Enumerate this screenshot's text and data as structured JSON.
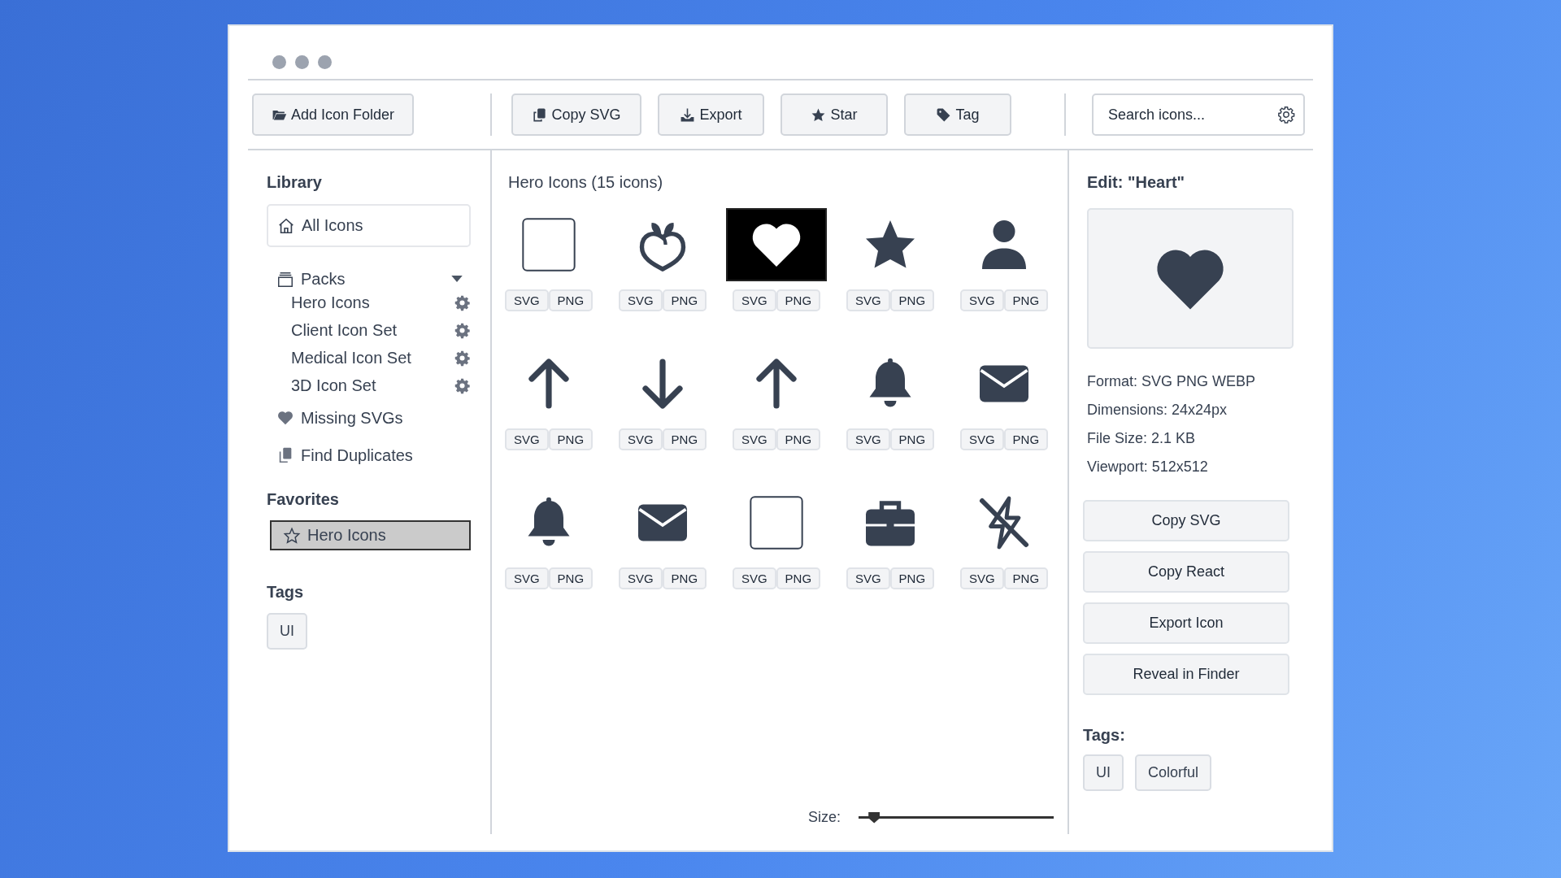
{
  "toolbar": {
    "primary": {
      "kind": "folder",
      "label": "Add Icon Folder"
    },
    "actions": [
      {
        "kind": "copy",
        "label": "Copy SVG"
      },
      {
        "kind": "download",
        "label": "Export"
      },
      {
        "kind": "star",
        "label": "Star"
      },
      {
        "kind": "tag",
        "label": "Tag"
      }
    ],
    "search": {
      "placeholder": "Search icons..."
    }
  },
  "sidebar": {
    "library": {
      "heading": "Library",
      "all": {
        "label": "All Icons",
        "selected": true
      },
      "packs": {
        "label": "Packs",
        "expanded": true,
        "children": [
          {
            "label": "Hero Icons"
          },
          {
            "label": "Client Icon Set"
          },
          {
            "label": "Medical Icon Set"
          },
          {
            "label": "3D Icon Set"
          }
        ]
      },
      "links": [
        {
          "kind": "heart",
          "label": "Missing SVGs"
        },
        {
          "kind": "duplicates",
          "label": "Find Duplicates"
        }
      ]
    },
    "favorites": {
      "heading": "Favorites",
      "items": [
        {
          "label": "Hero Icons",
          "selected": true
        }
      ]
    },
    "tags": {
      "heading": "Tags",
      "items": [
        "UI"
      ]
    }
  },
  "grid": {
    "title": "Hero Icons (15 icons)",
    "items": [
      {
        "kind": "square",
        "selected": false,
        "formats": [
          "SVG",
          "PNG"
        ]
      },
      {
        "kind": "peach",
        "selected": false,
        "formats": [
          "SVG",
          "PNG"
        ]
      },
      {
        "kind": "heart",
        "selected": true,
        "formats": [
          "SVG",
          "PNG"
        ]
      },
      {
        "kind": "star",
        "selected": false,
        "formats": [
          "SVG",
          "PNG"
        ]
      },
      {
        "kind": "user",
        "selected": false,
        "formats": [
          "SVG",
          "PNG"
        ]
      },
      {
        "kind": "arrow-up",
        "selected": false,
        "formats": [
          "SVG",
          "PNG"
        ]
      },
      {
        "kind": "arrow-down",
        "selected": false,
        "formats": [
          "SVG",
          "PNG"
        ]
      },
      {
        "kind": "arrow-up",
        "selected": false,
        "formats": [
          "SVG",
          "PNG"
        ]
      },
      {
        "kind": "bell",
        "selected": false,
        "formats": [
          "SVG",
          "PNG"
        ]
      },
      {
        "kind": "envelope",
        "selected": false,
        "formats": [
          "SVG",
          "PNG"
        ]
      },
      {
        "kind": "bell",
        "selected": false,
        "formats": [
          "SVG",
          "PNG"
        ]
      },
      {
        "kind": "envelope",
        "selected": false,
        "formats": [
          "SVG",
          "PNG"
        ]
      },
      {
        "kind": "square",
        "selected": false,
        "formats": [
          "SVG",
          "PNG"
        ]
      },
      {
        "kind": "briefcase",
        "selected": false,
        "formats": [
          "SVG",
          "PNG"
        ]
      },
      {
        "kind": "bolt-slash",
        "selected": false,
        "formats": [
          "SVG",
          "PNG"
        ]
      }
    ],
    "size": {
      "label": "Size:",
      "level": 0.08
    }
  },
  "details": {
    "title": "Edit: \"Heart\"",
    "preview": {
      "kind": "heart"
    },
    "info": [
      "Format: SVG PNG WEBP",
      "Dimensions: 24x24px",
      "File Size: 2.1 KB",
      "Viewport: 512x512"
    ],
    "buttons": [
      "Copy SVG",
      "Copy React",
      "Export Icon",
      "Reveal in Finder"
    ],
    "tags_heading": "Tags:",
    "tags": [
      "UI",
      "Colorful"
    ]
  }
}
